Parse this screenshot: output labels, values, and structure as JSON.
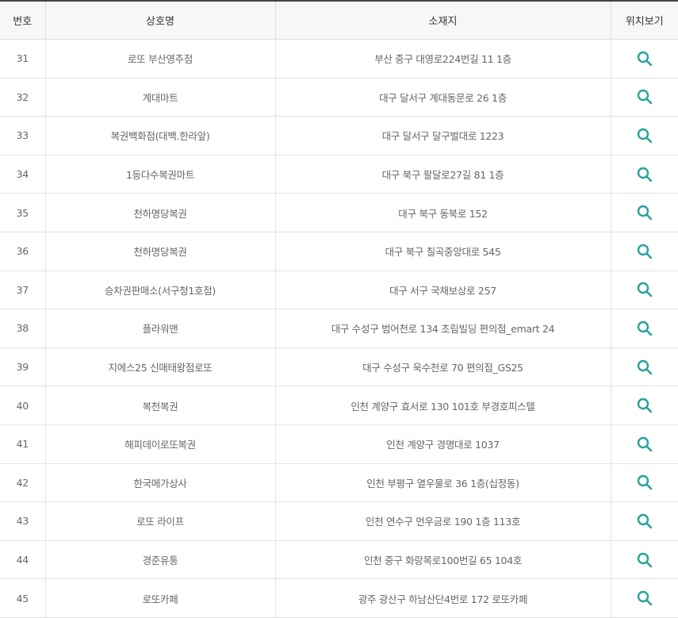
{
  "header": {
    "no": "번호",
    "name": "상호명",
    "address": "소재지",
    "map": "위치보기"
  },
  "colors": {
    "header_border": "#444444",
    "header_bg": "#f7f7f7",
    "icon": "#2aa39a"
  },
  "icon": "search-icon",
  "rows": [
    {
      "no": "31",
      "name": "로또 부산영주점",
      "address": "부산 중구 대영로224번길 11 1층"
    },
    {
      "no": "32",
      "name": "계대마트",
      "address": "대구 달서구 계대동문로 26 1층"
    },
    {
      "no": "33",
      "name": "복권백화점(대백.한라앞)",
      "address": "대구 달서구 달구벌대로 1223"
    },
    {
      "no": "34",
      "name": "1등다수복권마트",
      "address": "대구 북구 팔달로27길 81 1층"
    },
    {
      "no": "35",
      "name": "천하명당복권",
      "address": "대구 북구 동북로 152"
    },
    {
      "no": "36",
      "name": "천하명당복권",
      "address": "대구 북구 칠곡중앙대로 545"
    },
    {
      "no": "37",
      "name": "승차권판매소(서구청1호점)",
      "address": "대구 서구 국채보상로 257"
    },
    {
      "no": "38",
      "name": "플라워맨",
      "address": "대구 수성구 범어천로 134 초림빌딩 편의점_emart 24"
    },
    {
      "no": "39",
      "name": "지에스25 신매태왕점로또",
      "address": "대구 수성구 욱수천로 70 편의점_GS25"
    },
    {
      "no": "40",
      "name": "복천복권",
      "address": "인천 계양구 효서로 130 101호 부경호피스텔"
    },
    {
      "no": "41",
      "name": "해피데이로또복권",
      "address": "인천 계양구 경명대로 1037"
    },
    {
      "no": "42",
      "name": "한국메가상사",
      "address": "인천 부평구 열우물로 36 1층(십정동)"
    },
    {
      "no": "43",
      "name": "로또 라이프",
      "address": "인천 연수구 먼우금로 190 1층 113호"
    },
    {
      "no": "44",
      "name": "경준유통",
      "address": "인천 중구 화랑목로100번길 65 104호"
    },
    {
      "no": "45",
      "name": "로또카페",
      "address": "광주 광산구 하남산단4번로 172 로또카페"
    }
  ]
}
